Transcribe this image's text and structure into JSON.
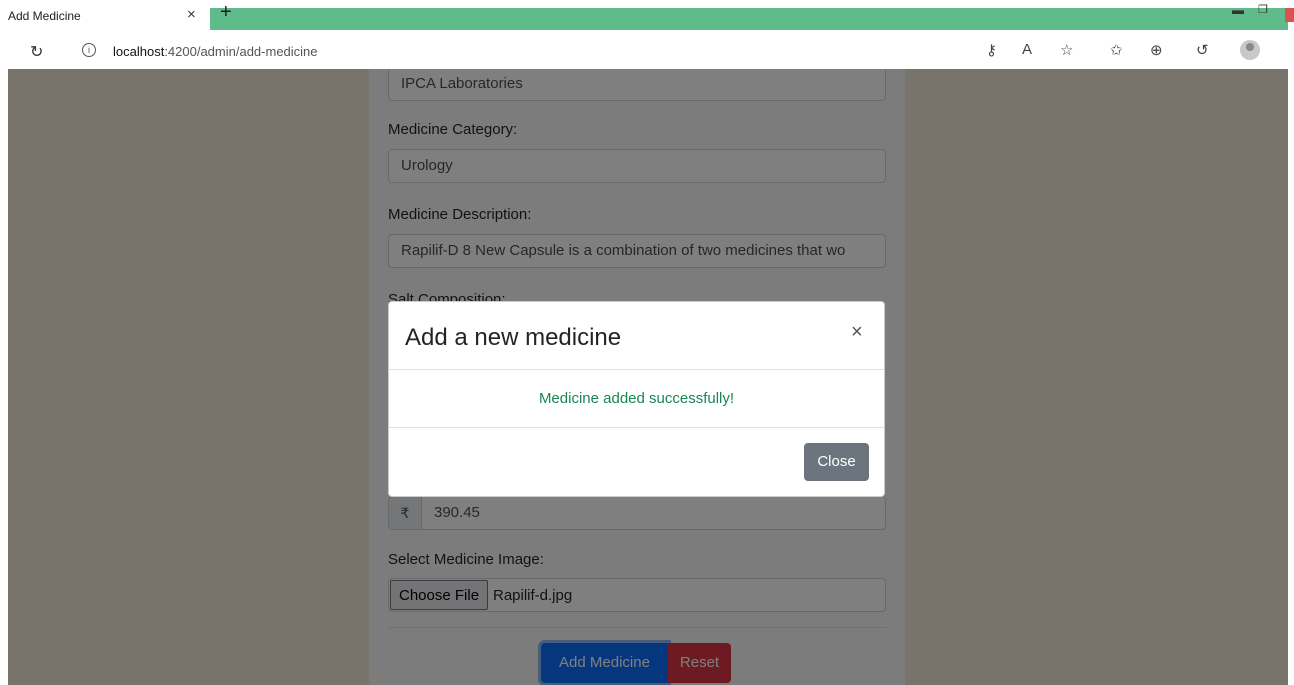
{
  "browser": {
    "tab_title": "Add Medicine",
    "tab_close": "×",
    "new_tab": "+",
    "url_host": "localhost",
    "url_path": ":4200/admin/add-medicine",
    "accent": "#5fbb8a"
  },
  "form": {
    "manufacturer_value": "IPCA Laboratories",
    "category_label": "Medicine Category:",
    "category_value": "Urology",
    "description_label": "Medicine Description:",
    "description_value": "Rapilif-D 8 New Capsule is a combination of two medicines that wo",
    "salt_label": "Salt Composition:",
    "currency_symbol": "₹",
    "price_value": "390.45",
    "image_label": "Select Medicine Image:",
    "choose_file_label": "Choose File",
    "file_name": "Rapilif-d.jpg",
    "add_button": "Add Medicine",
    "reset_button": "Reset"
  },
  "modal": {
    "title": "Add a new medicine",
    "close_x": "×",
    "message": "Medicine added successfully!",
    "close_button": "Close",
    "message_color": "#198754"
  }
}
